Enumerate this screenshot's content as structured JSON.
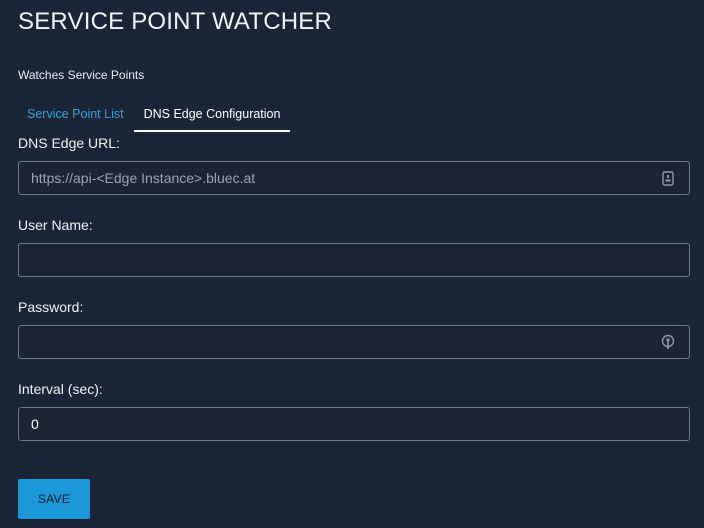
{
  "app": {
    "title": "SERVICE POINT WATCHER",
    "subtitle": "Watches Service Points"
  },
  "tabs": [
    {
      "label": "Service Point List",
      "active": false
    },
    {
      "label": "DNS Edge Configuration",
      "active": true
    }
  ],
  "form": {
    "dns_edge_url": {
      "label": "DNS Edge URL:",
      "value": "",
      "placeholder": "https://api-<Edge Instance>.bluec.at",
      "icon": "clipboard-icon"
    },
    "user_name": {
      "label": "User Name:",
      "value": "",
      "placeholder": ""
    },
    "password": {
      "label": "Password:",
      "value": "",
      "placeholder": "",
      "icon": "key-icon"
    },
    "interval": {
      "label": "Interval (sec):",
      "value": "0",
      "placeholder": ""
    },
    "save_label": "SAVE"
  },
  "colors": {
    "background": "#1a2538",
    "accent": "#1a98d8",
    "tab_inactive": "#3aa0d8",
    "field_border": "#6d7a8c"
  }
}
